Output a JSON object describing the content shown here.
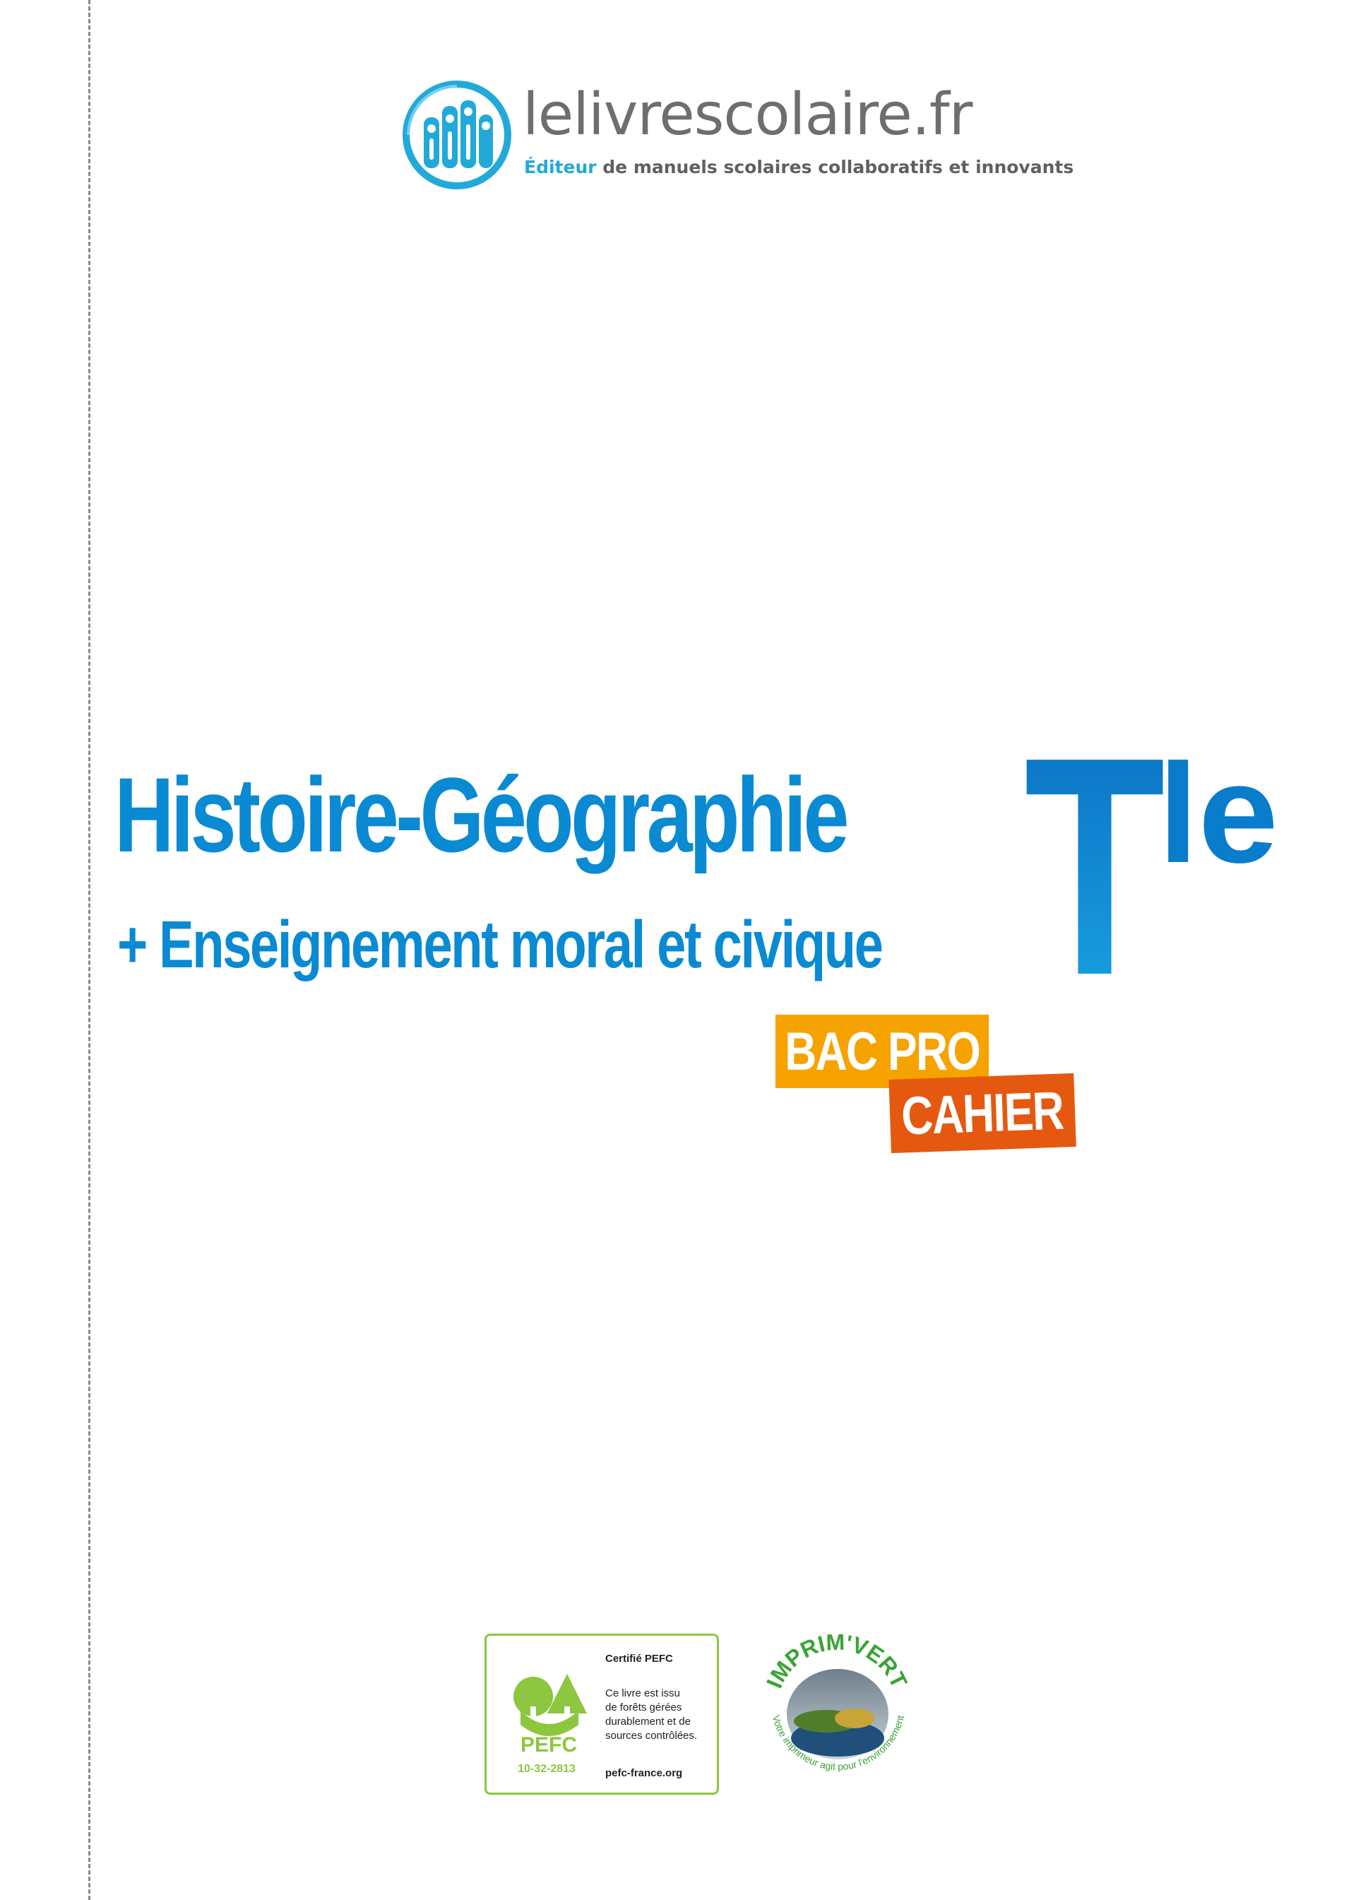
{
  "publisher": {
    "name": "lelivrescolaire.fr",
    "tagline_accent": "Éditeur",
    "tagline_rest": " de manuels scolaires collaboratifs et innovants"
  },
  "title": {
    "main": "Histoire-Géographie",
    "sub": "+ Enseignement moral et civique",
    "level_letter": "T",
    "level_suffix": "le"
  },
  "badges": {
    "bac_pro": "BAC PRO",
    "cahier": "CAHIER"
  },
  "certifications": {
    "pefc": {
      "title": "Certifié PEFC",
      "lines": [
        "Ce livre est issu",
        "de forêts gérées",
        "durablement et de",
        "sources contrôlées."
      ],
      "url": "pefc-france.org",
      "logo_text": "PEFC",
      "number": "10-32-2813"
    },
    "imprim_vert": {
      "name": "IMPRIM'VERT",
      "slogan": "Votre imprimeur agit pour l'environnement"
    }
  },
  "colors": {
    "title_blue": "#0a8ad2",
    "cyan": "#22a9d8",
    "bac_orange": "#f6a300",
    "cahier_orange": "#e5580f",
    "pefc_green": "#8dc63f",
    "imprimvert_green": "#3aa335"
  }
}
